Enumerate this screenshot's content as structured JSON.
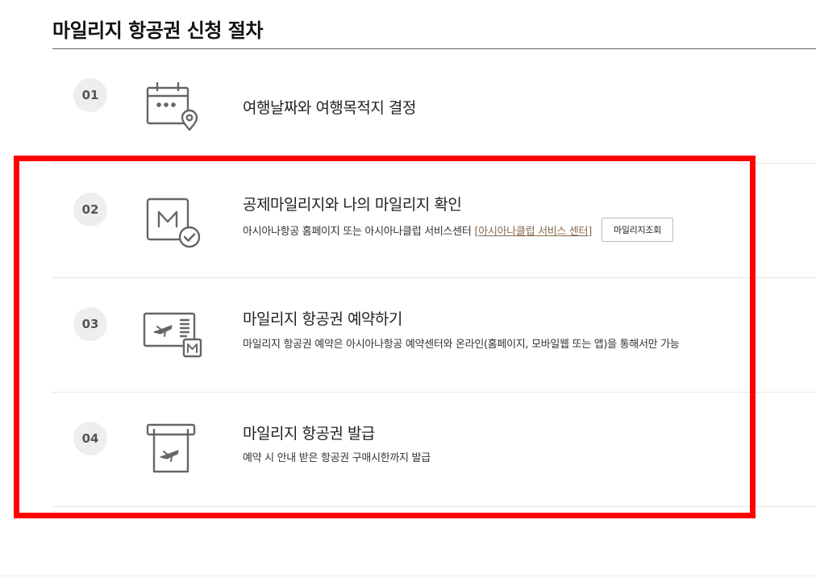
{
  "page": {
    "title": "마일리지 항공권 신청 절차"
  },
  "steps": [
    {
      "number": "01",
      "icon": "calendar-location-icon",
      "title": "여행날짜와 여행목적지 결정"
    },
    {
      "number": "02",
      "icon": "mileage-check-icon",
      "title": "공제마일리지와 나의 마일리지 확인",
      "description": "아시아나항공 홈페이지 또는 아시아나클럽 서비스센터",
      "link_open": "[",
      "link_label": "아시아나클럽 서비스 센터",
      "link_close": "]",
      "button_label": "마일리지조회"
    },
    {
      "number": "03",
      "icon": "ticket-mileage-icon",
      "title": "마일리지 항공권 예약하기",
      "description": "마일리지 항공권 예약은 아시아나항공 예약센터와 온라인(홈페이지, 모바일웹 또는 앱)을 통해서만 가능"
    },
    {
      "number": "04",
      "icon": "ticket-issue-icon",
      "title": "마일리지 항공권 발급",
      "description": "예약 시 안내 받은 항공권 구매시한까지 발급"
    }
  ],
  "colors": {
    "highlight": "#ff0000",
    "link": "#8a6a4e",
    "badge_bg": "#eeeeee",
    "icon_stroke": "#666666"
  }
}
